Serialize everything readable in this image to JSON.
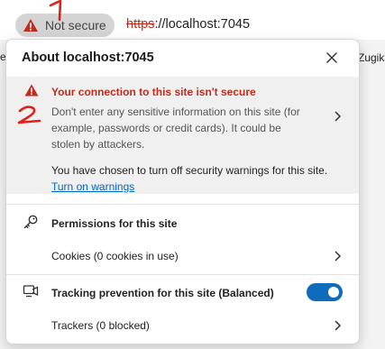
{
  "addressbar": {
    "security_chip_label": "Not secure",
    "url_scheme": "https",
    "url_rest": "://localhost:7045",
    "annotation_1": "1"
  },
  "bookmarks_bar": {
    "left_item": "e",
    "right_item": "Zugik"
  },
  "panel": {
    "title": "About localhost:7045",
    "warning": {
      "title": "Your connection to this site isn't secure",
      "description": "Don't enter any sensitive information on this site (for example, passwords or credit cards). It could be stolen by attackers.",
      "annotation_2": "2"
    },
    "security_off": {
      "text": "You have chosen to turn off security warnings for this site.",
      "link": "Turn on warnings"
    },
    "permissions": {
      "label": "Permissions for this site"
    },
    "cookies": {
      "label": "Cookies (0 cookies in use)"
    },
    "tracking": {
      "label": "Tracking prevention for this site (Balanced)",
      "enabled": true
    },
    "trackers": {
      "label": "Trackers (0 blocked)"
    }
  },
  "colors": {
    "warning_red": "#c42b1c",
    "link_blue": "#0066cc",
    "toggle_blue": "#0f6cbd",
    "annotation_red": "#e0201a"
  },
  "icons": [
    "warning-icon",
    "close-icon",
    "chevron-right-icon",
    "key-icon",
    "tracking-icon"
  ]
}
